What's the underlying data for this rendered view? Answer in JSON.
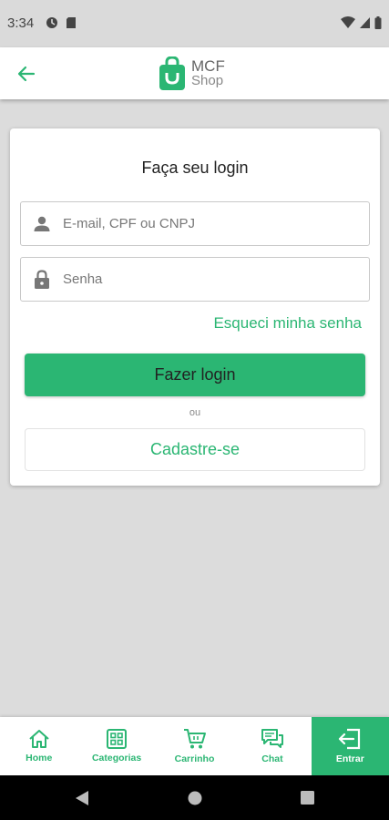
{
  "status_bar": {
    "time": "3:34"
  },
  "app_bar": {
    "logo_line1": "MCF",
    "logo_line2": "Shop"
  },
  "login_card": {
    "title": "Faça seu login",
    "email_placeholder": "E-mail, CPF ou CNPJ",
    "password_placeholder": "Senha",
    "forgot_password": "Esqueci minha senha",
    "login_button": "Fazer login",
    "separator": "ou",
    "signup_button": "Cadastre-se"
  },
  "bottom_nav": {
    "items": [
      {
        "label": "Home",
        "icon": "home-icon"
      },
      {
        "label": "Categorias",
        "icon": "grid-icon"
      },
      {
        "label": "Carrinho",
        "icon": "cart-icon"
      },
      {
        "label": "Chat",
        "icon": "chat-icon"
      },
      {
        "label": "Entrar",
        "icon": "login-icon",
        "active": true
      }
    ]
  },
  "colors": {
    "accent": "#2bb673",
    "background": "#dcdcdc",
    "status_bar": "#dadada"
  }
}
